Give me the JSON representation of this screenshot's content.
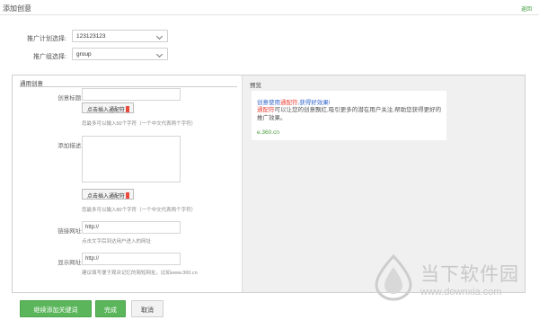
{
  "header": {
    "title": "添加创意",
    "back_link": "返回"
  },
  "form": {
    "plan_label": "推广计划选择:",
    "plan_value": "123123123",
    "group_label": "推广组选择:",
    "group_value": "group"
  },
  "creative": {
    "section_title": "通用创意",
    "title_label": "创意标题:",
    "insert_wildcard": "点击插入通配符",
    "title_hint": "您最多可以输入50个字符（一个中文代表两个字符）",
    "desc_label": "添加描述:",
    "desc_hint": "您最多可以输入80个字符（一个中文代表两个字符）",
    "link_label": "链接网址:",
    "link_value": "http://",
    "link_hint": "点击文字后到达用户进入的网址",
    "display_label": "显示网址:",
    "display_value": "http://",
    "display_hint": "建议填写便于观众记忆的简短网址，比如www.360.cn"
  },
  "preview": {
    "title": "预览",
    "line1_pre": "创意使用",
    "line1_red": "通配符",
    "line1_post": ",获得好效果!",
    "line2_red": "通配符",
    "line2_text": "可以让您的创意飘红,吸引更多的潜在用户关注,帮助您获得更好的推广效果。",
    "url": "e.360.cn"
  },
  "footer": {
    "continue_label": "继续添加关键词",
    "done_label": "完成",
    "cancel_label": "取消"
  },
  "watermark": {
    "title": "当下软件园",
    "url": "www.downxia.com"
  },
  "colors": {
    "accent_green": "#5bb55b",
    "highlight_red": "#e8443a",
    "link_blue": "#3366cc"
  }
}
